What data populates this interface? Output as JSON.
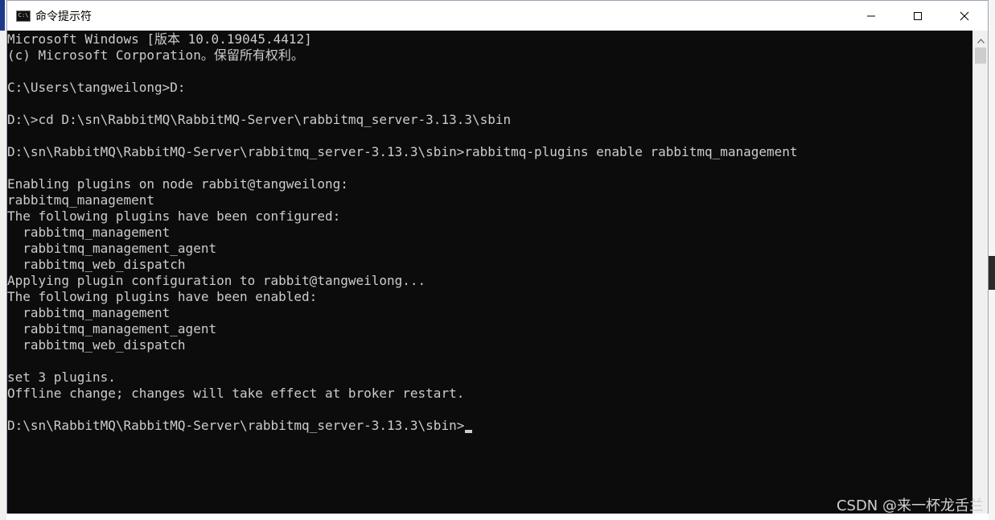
{
  "window": {
    "title": "命令提示符",
    "app_icon_text": "C:\\"
  },
  "console": {
    "lines": [
      "Microsoft Windows [版本 10.0.19045.4412]",
      "(c) Microsoft Corporation。保留所有权利。",
      "",
      "C:\\Users\\tangweilong>D:",
      "",
      "D:\\>cd D:\\sn\\RabbitMQ\\RabbitMQ-Server\\rabbitmq_server-3.13.3\\sbin",
      "",
      "D:\\sn\\RabbitMQ\\RabbitMQ-Server\\rabbitmq_server-3.13.3\\sbin>rabbitmq-plugins enable rabbitmq_management",
      "",
      "Enabling plugins on node rabbit@tangweilong:",
      "rabbitmq_management",
      "The following plugins have been configured:",
      "  rabbitmq_management",
      "  rabbitmq_management_agent",
      "  rabbitmq_web_dispatch",
      "Applying plugin configuration to rabbit@tangweilong...",
      "The following plugins have been enabled:",
      "  rabbitmq_management",
      "  rabbitmq_management_agent",
      "  rabbitmq_web_dispatch",
      "",
      "set 3 plugins.",
      "Offline change; changes will take effect at broker restart.",
      ""
    ],
    "prompt": "D:\\sn\\RabbitMQ\\RabbitMQ-Server\\rabbitmq_server-3.13.3\\sbin>"
  },
  "icons": {
    "minimize": "minimize-icon",
    "maximize": "maximize-icon",
    "close": "close-icon",
    "scroll_up": "chevron-up-icon"
  },
  "colors": {
    "console_bg": "#0c0c0c",
    "console_fg": "#cccccc"
  },
  "watermark": "CSDN @来一杯龙舌兰"
}
